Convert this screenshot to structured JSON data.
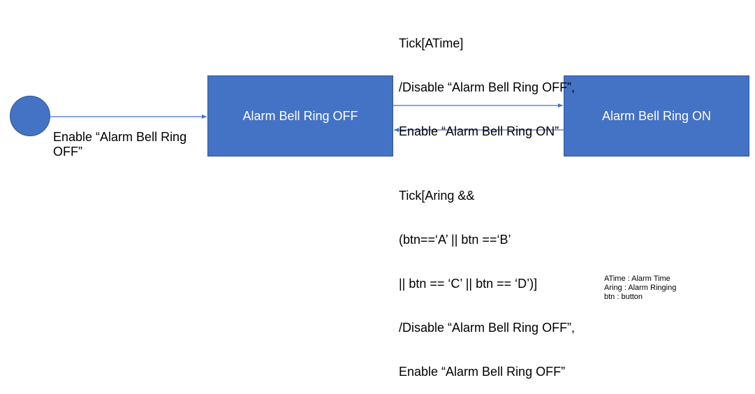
{
  "diagram": {
    "initial_state_label": "Enable “Alarm Bell Ring OFF”",
    "states": {
      "off": "Alarm Bell Ring OFF",
      "on": "Alarm Bell Ring ON"
    },
    "transitions": {
      "off_to_on": [
        "Tick[ATime]",
        "/Disable “Alarm Bell Ring OFF”,",
        "Enable “Alarm Bell Ring ON”"
      ],
      "on_to_off": [
        "Tick[Aring &&",
        "(btn==‘A’ || btn ==‘B’",
        "|| btn == ‘C’ || btn == ‘D’)]",
        "/Disable “Alarm Bell Ring OFF”,",
        "Enable “Alarm Bell Ring OFF”"
      ]
    },
    "legend": [
      "ATime : Alarm Time",
      "Aring : Alarm Ringing",
      "btn : button"
    ],
    "colors": {
      "state_fill": "#4472c4",
      "state_border": "#2f5597",
      "arrow": "#4472c4"
    }
  }
}
